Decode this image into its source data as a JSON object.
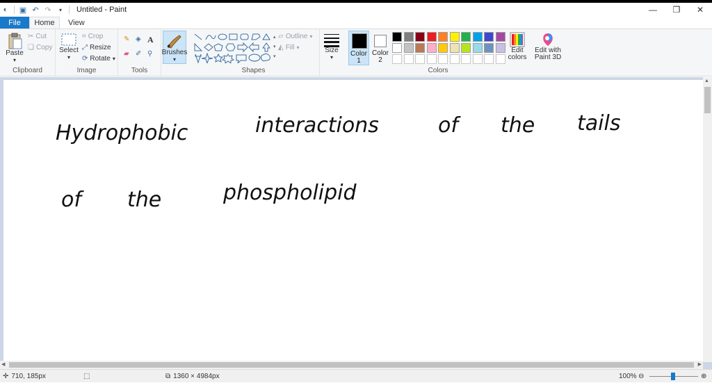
{
  "window": {
    "title": "Untitled - Paint"
  },
  "tabs": [
    {
      "label": "File"
    },
    {
      "label": "Home"
    },
    {
      "label": "View"
    }
  ],
  "clipboard": {
    "group_label": "Clipboard",
    "paste": "Paste",
    "cut": "Cut",
    "copy": "Copy"
  },
  "image": {
    "group_label": "Image",
    "select": "Select",
    "crop": "Crop",
    "resize": "Resize",
    "rotate": "Rotate"
  },
  "tools": {
    "group_label": "Tools"
  },
  "brushes": {
    "label": "Brushes"
  },
  "shapes": {
    "group_label": "Shapes",
    "outline": "Outline",
    "fill": "Fill"
  },
  "size": {
    "label": "Size"
  },
  "color1": {
    "label": "Color",
    "num": "1"
  },
  "color2": {
    "label": "Color",
    "num": "2"
  },
  "colors": {
    "group_label": "Colors",
    "edit_colors": "Edit colors",
    "palette_row1": [
      "#000000",
      "#7f7f7f",
      "#880015",
      "#ed1c24",
      "#ff7f27",
      "#fff200",
      "#22b14c",
      "#00a2e8",
      "#3f48cc",
      "#a349a4"
    ],
    "palette_row2": [
      "#ffffff",
      "#c3c3c3",
      "#b97a57",
      "#ffaec9",
      "#ffc90e",
      "#efe4b0",
      "#b5e61d",
      "#99d9ea",
      "#7092be",
      "#c8bfe7"
    ]
  },
  "paint3d": {
    "label": "Edit with Paint 3D"
  },
  "canvas": {
    "line1": [
      "Hydrophobic",
      "interactions",
      "of",
      "the",
      "tails"
    ],
    "line2": [
      "of",
      "the",
      "phospholipid"
    ]
  },
  "status": {
    "cursor": "710, 185px",
    "canvas_size": "1360 × 4984px",
    "zoom": "100%"
  }
}
